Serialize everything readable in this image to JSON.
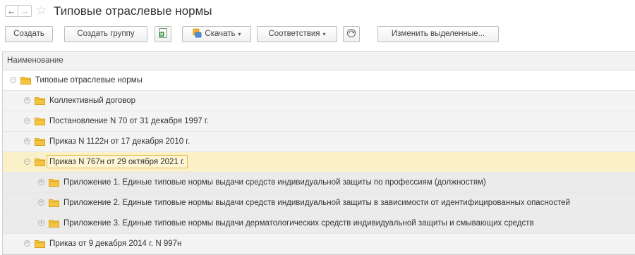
{
  "window": {
    "title": "Типовые отраслевые нормы",
    "back_glyph": "←",
    "forward_glyph": "→",
    "favorite_glyph": "☆"
  },
  "toolbar": {
    "create_label": "Создать",
    "create_group_label": "Создать группу",
    "download_label": "Скачать",
    "mappings_label": "Соответствия",
    "edit_selected_label": "Изменить выделенные...",
    "dropdown_glyph": "▾"
  },
  "table": {
    "column_header": "Наименование",
    "expanded_glyph": "−",
    "collapsed_glyph": "+",
    "rows": [
      {
        "label": "Типовые отраслевые нормы",
        "level": 0,
        "expanded": true
      },
      {
        "label": "Коллективный договор",
        "level": 1,
        "expanded": false
      },
      {
        "label": "Постановление N 70 от 31 декабря 1997 г.",
        "level": 1,
        "expanded": false
      },
      {
        "label": "Приказ N 1122н от 17 декабря 2010 г.",
        "level": 1,
        "expanded": false
      },
      {
        "label": "Приказ N 767н от 29 октября 2021 г.",
        "level": 1,
        "expanded": true,
        "selected": true
      },
      {
        "label": "Приложение 1. Единые типовые нормы выдачи средств индивидуальной защиты по профессиям (должностям)",
        "level": 2,
        "expanded": false
      },
      {
        "label": "Приложение 2. Единые типовые нормы выдачи средств индивидуальной защиты в зависимости от идентифицированных опасностей",
        "level": 2,
        "expanded": false
      },
      {
        "label": "Приложение 3. Единые типовые нормы выдачи дерматологических средств индивидуальной защиты и смывающих средств",
        "level": 2,
        "expanded": false
      },
      {
        "label": "Приказ от 9 декабря 2014 г. N 997н",
        "level": 1,
        "expanded": false
      }
    ]
  },
  "colors": {
    "folder_fill": "#f5c542",
    "folder_stroke": "#d9a21b",
    "selected_row": "#fbf1c9",
    "selected_border": "#e9b94a"
  }
}
